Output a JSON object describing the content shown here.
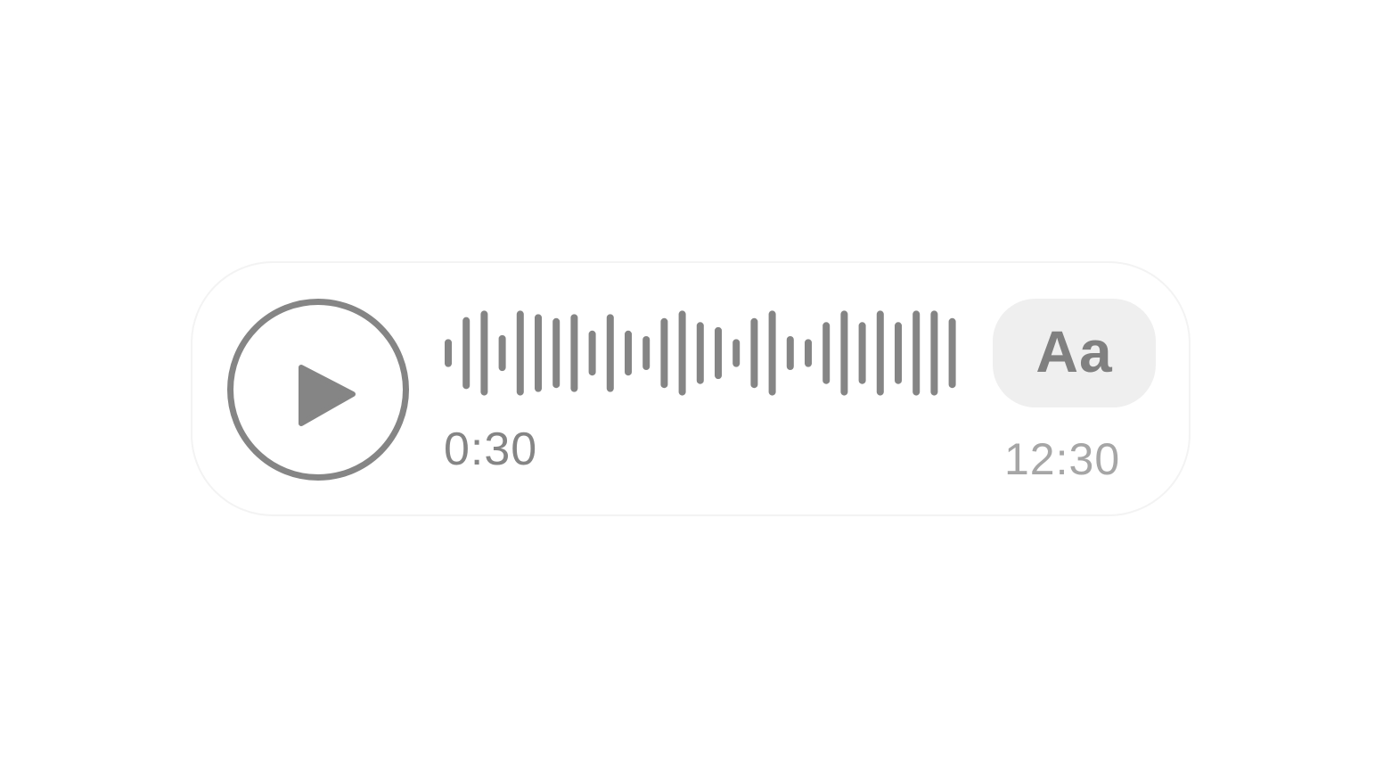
{
  "voice_message": {
    "play_icon": "play-icon",
    "waveform_levels": [
      0.28,
      0.72,
      0.85,
      0.36,
      0.85,
      0.78,
      0.7,
      0.78,
      0.45,
      0.78,
      0.45,
      0.34,
      0.7,
      0.85,
      0.62,
      0.52,
      0.28,
      0.7,
      0.85,
      0.34,
      0.28,
      0.62,
      0.85,
      0.62,
      0.85,
      0.62,
      0.85,
      0.85,
      0.7
    ],
    "elapsed": "0:30",
    "transcribe_label": "Aa",
    "timestamp": "12:30"
  },
  "colors": {
    "icon_gray": "#858585",
    "timestamp_gray": "#a6a6a6",
    "button_background": "#efefef",
    "bubble_border": "#f3f3f3"
  }
}
